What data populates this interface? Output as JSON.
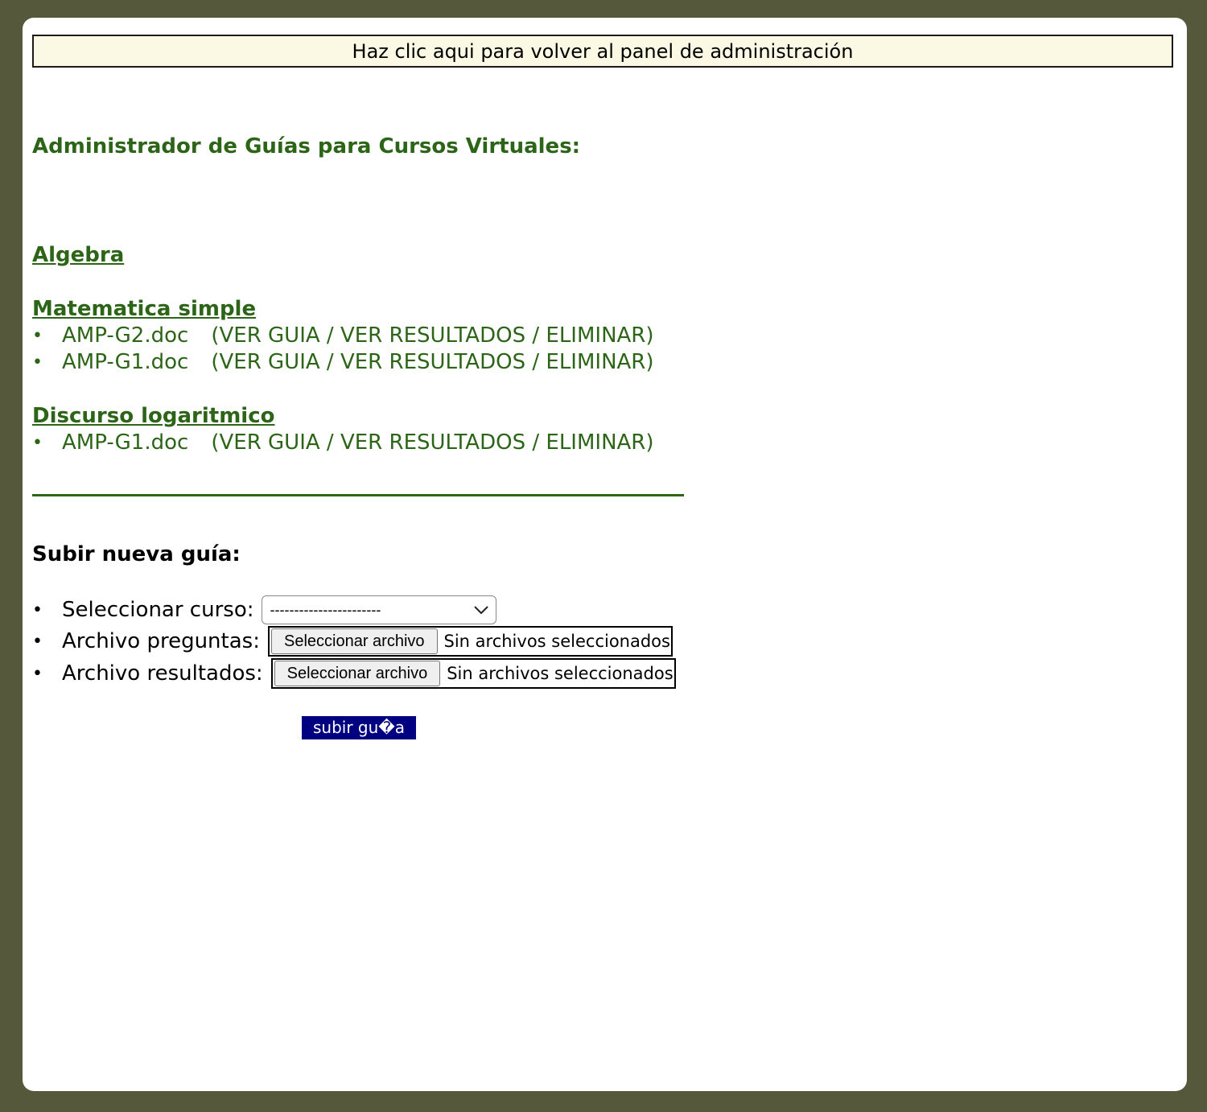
{
  "header": {
    "back_link": "Haz clic aqui para volver al panel de administración"
  },
  "page_title": "Administrador de Guías para Cursos Virtuales:",
  "courses": [
    {
      "name": "Algebra",
      "guides": []
    },
    {
      "name": "Matematica simple",
      "guides": [
        {
          "file": "AMP-G2.doc",
          "open_paren": "(",
          "view_guide": "VER GUIA",
          "sep1": " / ",
          "view_results": "VER RESULTADOS",
          "sep2": " / ",
          "delete": "ELIMINAR",
          "close_paren": ")"
        },
        {
          "file": "AMP-G1.doc",
          "open_paren": "(",
          "view_guide": "VER GUIA",
          "sep1": " / ",
          "view_results": "VER RESULTADOS",
          "sep2": " / ",
          "delete": "ELIMINAR",
          "close_paren": ")"
        }
      ]
    },
    {
      "name": "Discurso logaritmico",
      "guides": [
        {
          "file": "AMP-G1.doc",
          "open_paren": "(",
          "view_guide": "VER GUIA",
          "sep1": " / ",
          "view_results": "VER RESULTADOS",
          "sep2": " / ",
          "delete": "ELIMINAR",
          "close_paren": ")"
        }
      ]
    }
  ],
  "upload": {
    "title": "Subir nueva guía:",
    "bullet": "•",
    "course_label": "Seleccionar curso:",
    "course_selected": "-----------------------",
    "questions_label": "Archivo preguntas:",
    "results_label": "Archivo resultados:",
    "file_button": "Seleccionar archivo",
    "file_status": "Sin archivos seleccionados",
    "submit": "subir gu�a"
  },
  "colors": {
    "frame": "#55583a",
    "accent_green": "#2d6518",
    "back_link_bg": "#fbf9e4",
    "submit_bg": "#000080"
  },
  "icons": {
    "select_arrow": "chevron-down-icon"
  }
}
